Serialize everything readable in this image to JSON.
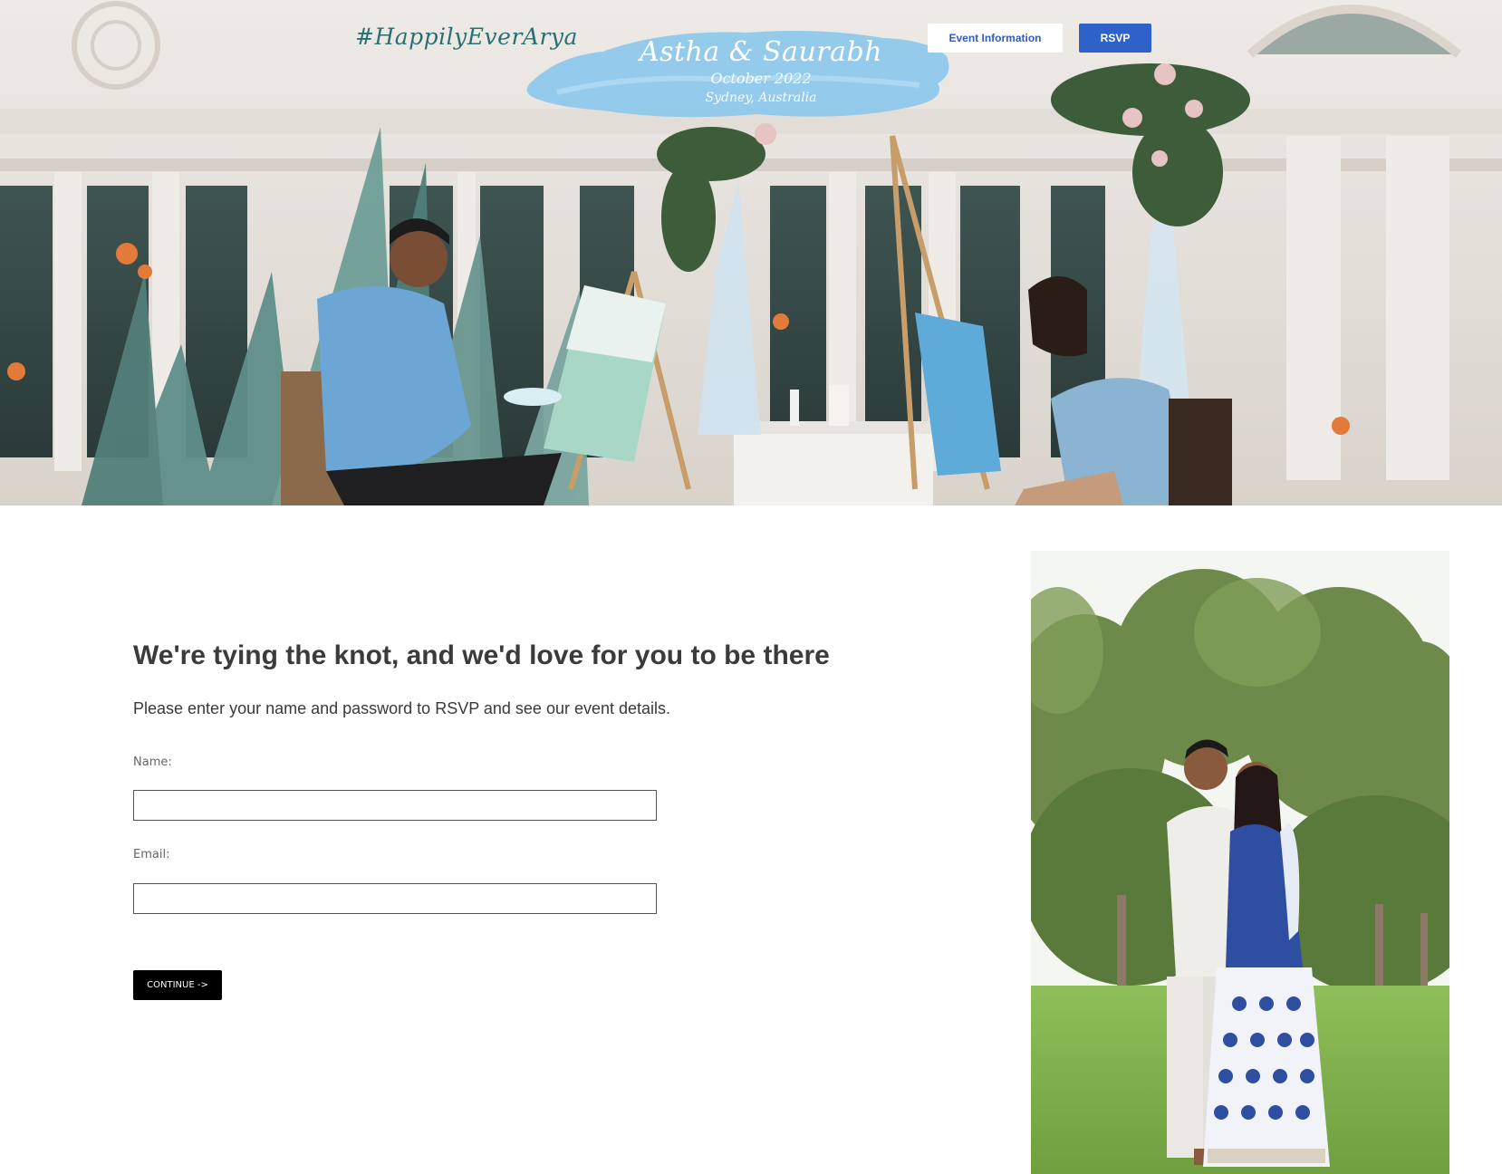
{
  "header": {
    "hashtag": "#HappilyEverArya",
    "couple_names": "Astha & Saurabh",
    "date": "October 2022",
    "location": "Sydney, Australia",
    "nav": {
      "event_information": "Event Information",
      "rsvp": "RSVP"
    },
    "colors": {
      "hashtag": "#2b6f73",
      "brush": "#8cc8ec",
      "nav_button_accent": "#2e62c9"
    }
  },
  "main": {
    "headline": "We're tying the knot, and we'd love for you to be there",
    "subtext": "Please enter your name and password to RSVP and see our event details.",
    "form": {
      "name_label": "Name:",
      "name_value": "",
      "email_label": "Email:",
      "email_value": "",
      "continue_label": "CONTINUE ->"
    }
  }
}
